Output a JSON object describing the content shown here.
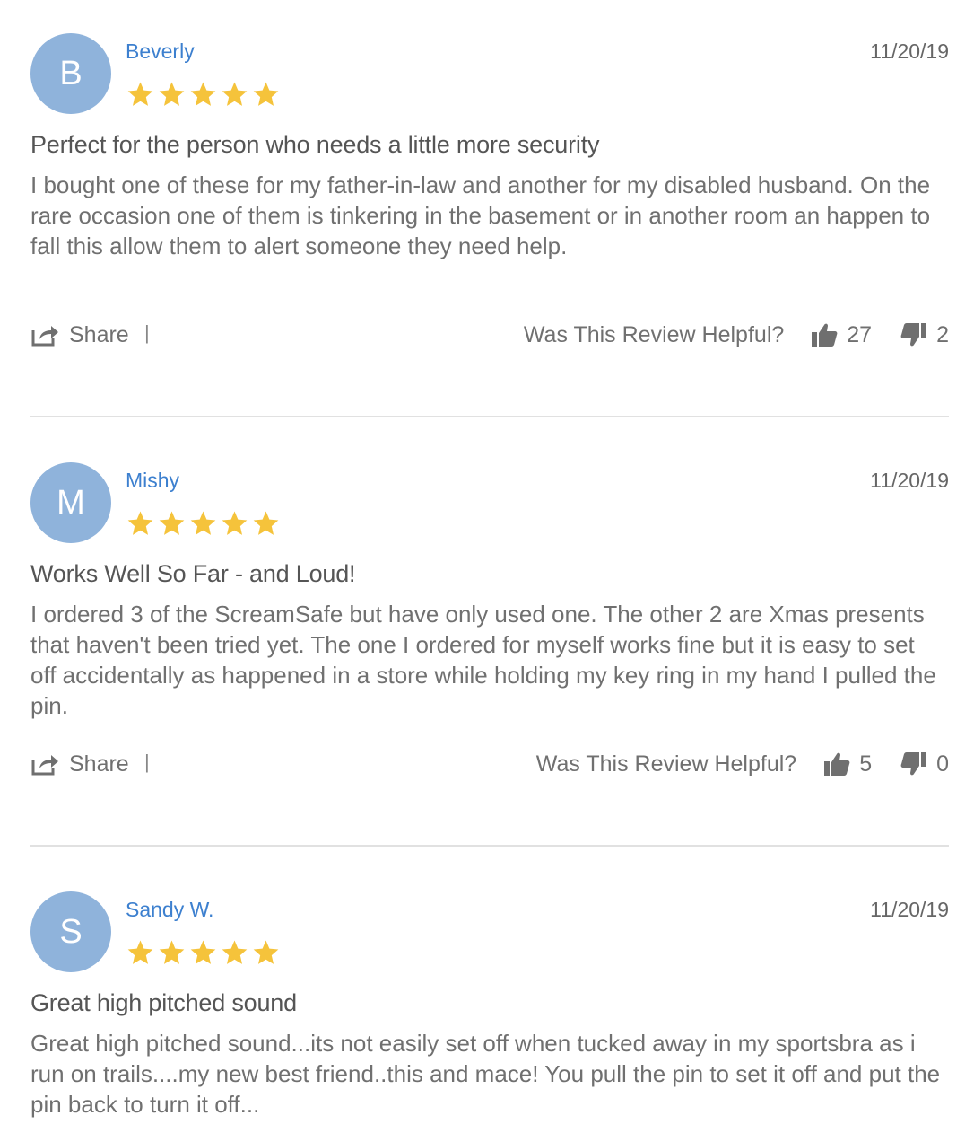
{
  "helpful_label": "Was This Review Helpful?",
  "share_label": "Share",
  "separator": "|",
  "colors": {
    "avatar": "#8fb3db",
    "author": "#3d80cf",
    "star": "#f5c33b",
    "text": "#707070"
  },
  "reviews": [
    {
      "initial": "B",
      "author": "Beverly",
      "date": "11/20/19",
      "rating": 5,
      "title": "Perfect for the person who needs a little more security",
      "body": "I bought one of these for my father-in-law and another for my disabled husband. On the rare occasion one of them is tinkering in the basement or in another room an happen to fall this allow them to alert someone they need help.",
      "helpful_yes": "27",
      "helpful_no": "2"
    },
    {
      "initial": "M",
      "author": "Mishy",
      "date": "11/20/19",
      "rating": 5,
      "title": "Works Well So Far - and Loud!",
      "body": "I ordered 3 of the ScreamSafe but have only used one. The other 2 are Xmas presents that haven't been tried yet. The one I ordered for myself works fine but it is easy to set off accidentally as happened in a store while holding my key ring in my hand I pulled the pin.",
      "helpful_yes": "5",
      "helpful_no": "0"
    },
    {
      "initial": "S",
      "author": "Sandy W.",
      "date": "11/20/19",
      "rating": 5,
      "title": "Great high pitched sound",
      "body": "Great high pitched sound...its not easily set off when tucked away in my sportsbra as i run on trails....my new best friend..this and mace! You pull the pin to set it off and put the pin back to turn it off..."
    }
  ]
}
